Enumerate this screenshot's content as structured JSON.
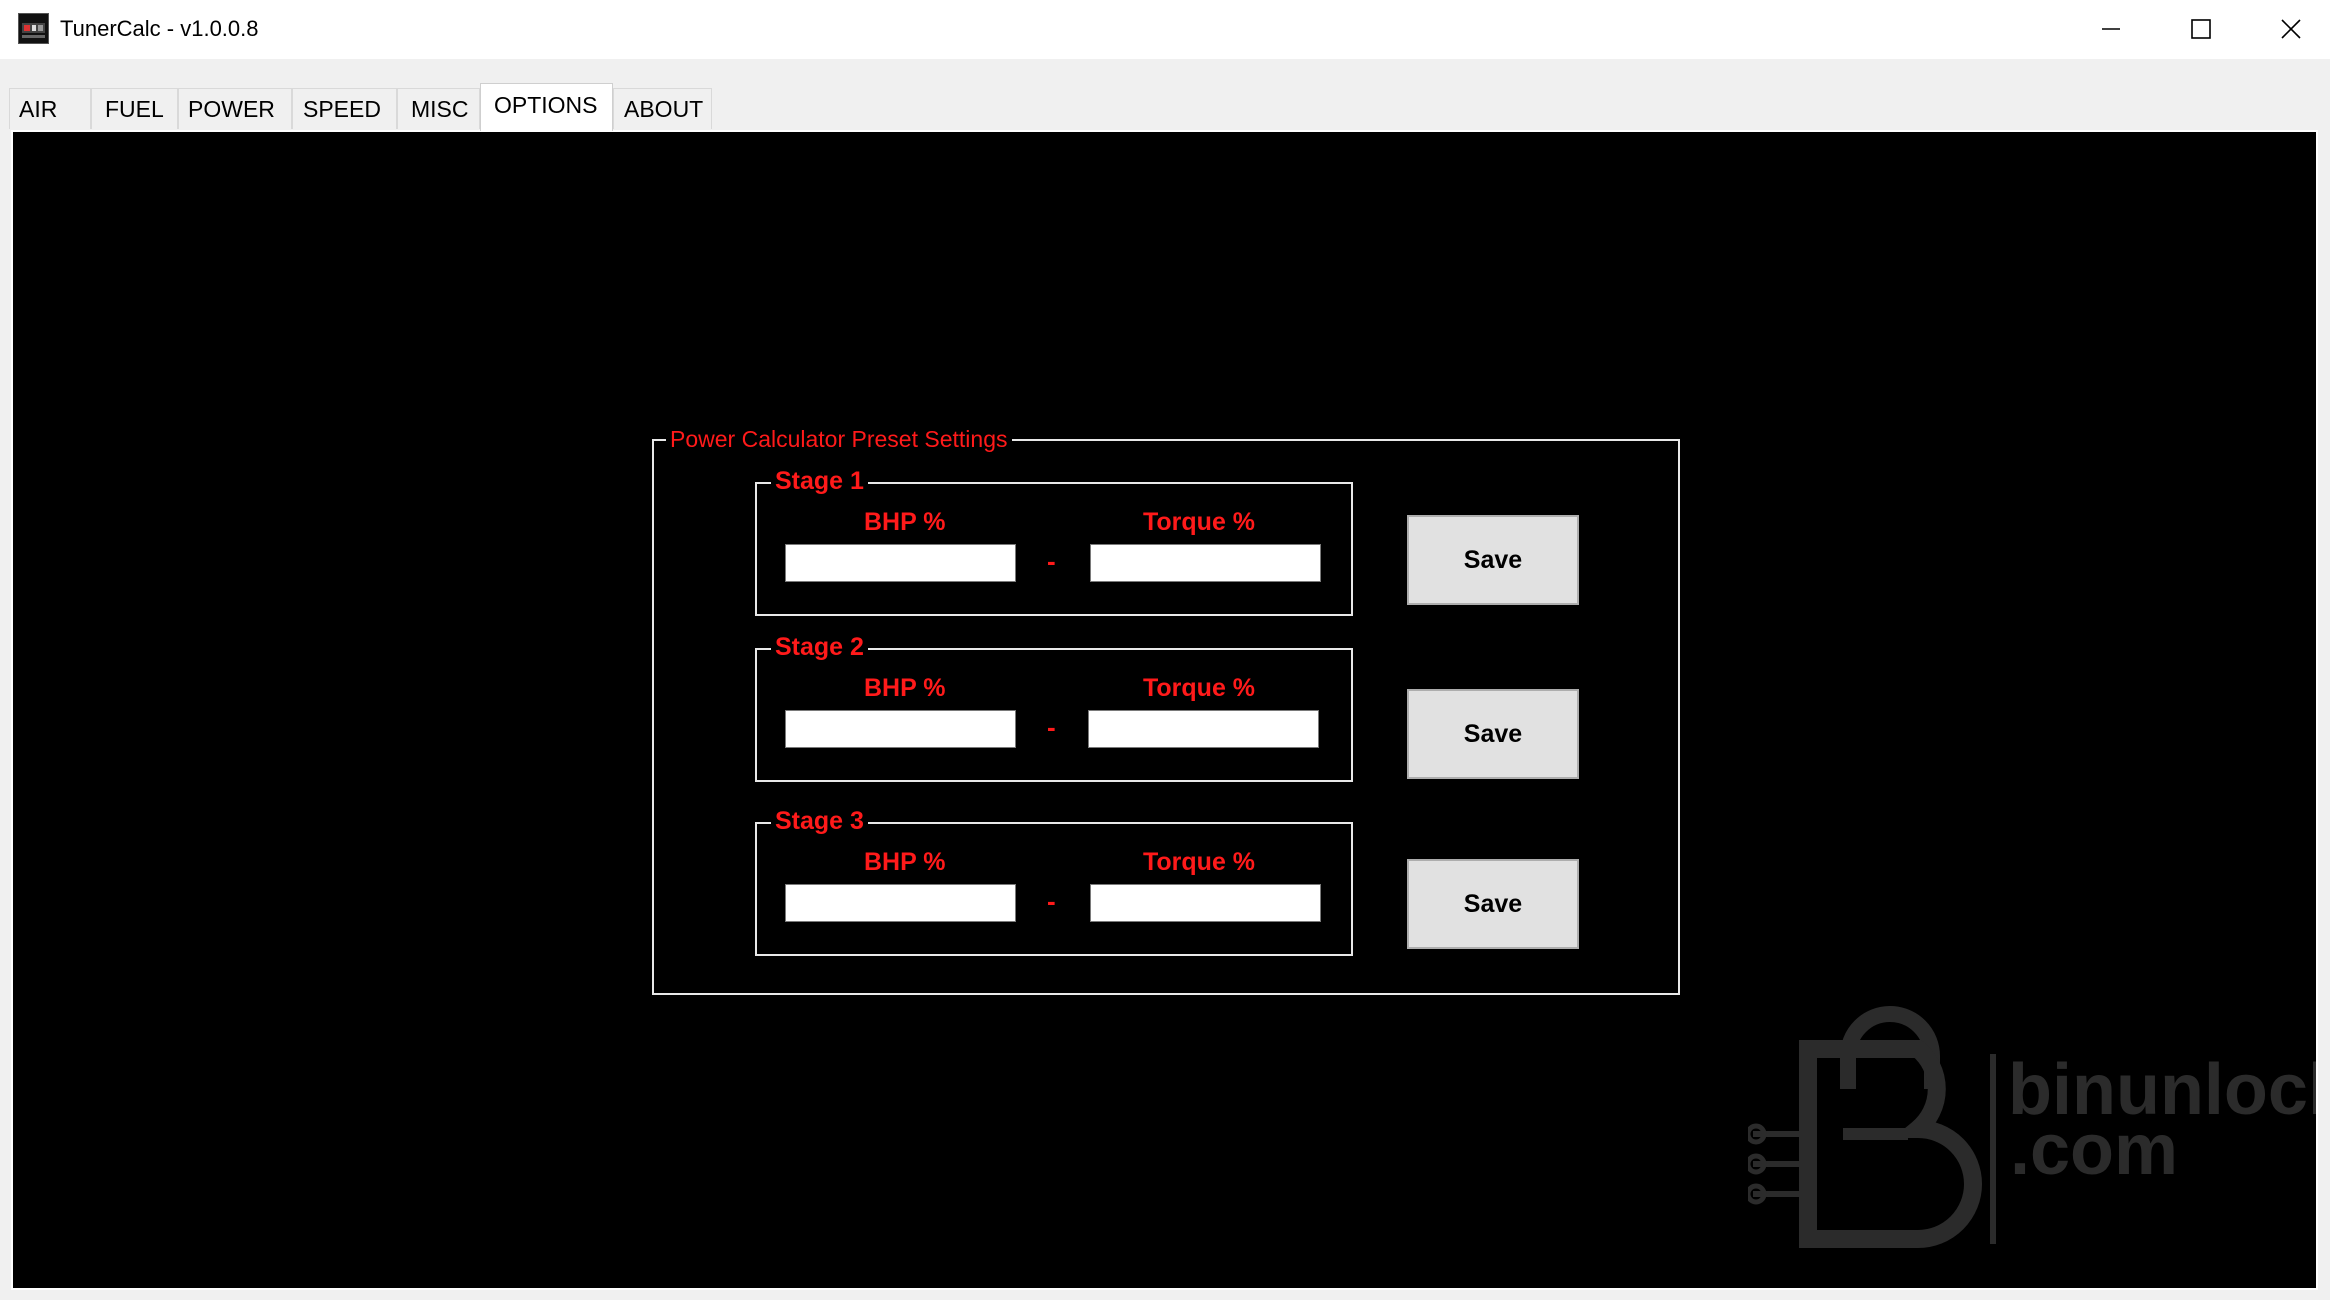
{
  "window": {
    "title": "TunerCalc - v1.0.0.8",
    "icon": "app-logo-icon",
    "controls": [
      "minimize-icon",
      "maximize-icon",
      "close-icon"
    ]
  },
  "tabs": [
    {
      "label": "AIR",
      "active": false
    },
    {
      "label": "FUEL",
      "active": false
    },
    {
      "label": "POWER",
      "active": false
    },
    {
      "label": "SPEED",
      "active": false
    },
    {
      "label": "MISC",
      "active": false
    },
    {
      "label": "OPTIONS",
      "active": true
    },
    {
      "label": "ABOUT",
      "active": false
    }
  ],
  "options": {
    "group_title": "Power Calculator Preset Settings",
    "bhp_label": "BHP %",
    "torque_label": "Torque %",
    "separator": "-",
    "save_label": "Save",
    "stages": [
      {
        "title": "Stage 1",
        "bhp_value": "",
        "torque_value": ""
      },
      {
        "title": "Stage 2",
        "bhp_value": "",
        "torque_value": ""
      },
      {
        "title": "Stage 3",
        "bhp_value": "",
        "torque_value": ""
      }
    ]
  },
  "watermark": {
    "line1": "binunlock",
    "line2": ".com"
  },
  "colors": {
    "accent_red": "#ff1a1a",
    "panel_background": "#000000",
    "watermark_gray": "#2e2e2e"
  }
}
